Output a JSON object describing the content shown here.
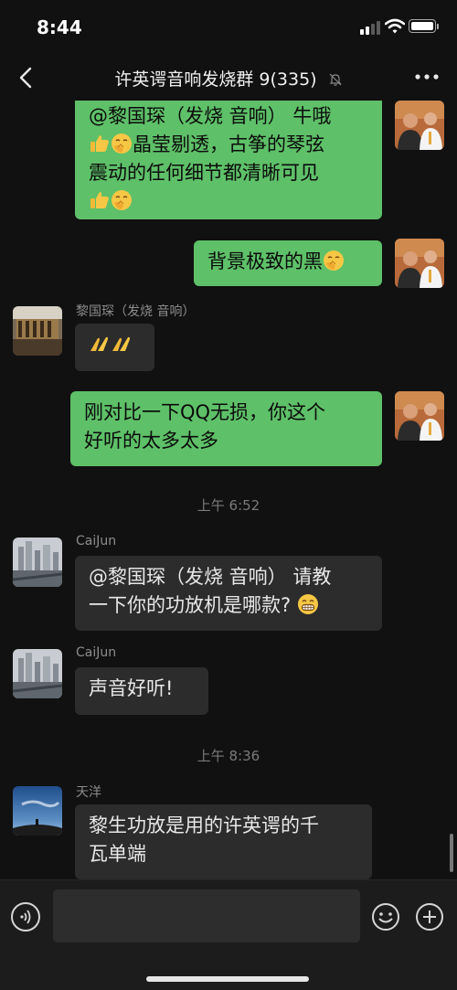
{
  "status": {
    "time": "8:44"
  },
  "header": {
    "title": "许英谔音响发烧群 9(335)"
  },
  "messages": {
    "m1": {
      "line1": "@黎国琛（发烧 音响） 牛哦",
      "line2_text": "晶莹剔透，古筝的琴弦",
      "line3": "震动的任何细节都清晰可见"
    },
    "m2": {
      "text": "背景极致的黑"
    },
    "m3": {
      "sender": "黎国琛（发烧 音响）"
    },
    "m4": {
      "line1": "刚对比一下QQ无损，你这个",
      "line2": "好听的太多太多"
    },
    "time1": "上午 6:52",
    "m5": {
      "sender": "CaiJun",
      "line1": "@黎国琛（发烧 音响） 请教",
      "line2": "一下你的功放机是哪款?"
    },
    "m6": {
      "sender": "CaiJun",
      "text": "声音好听!"
    },
    "time2": "上午 8:36",
    "m7": {
      "sender": "天洋",
      "line1": "黎生功放是用的许英谔的千",
      "line2": "瓦单端"
    }
  },
  "colors": {
    "my_bubble": "#5ec068",
    "other_bubble": "#2c2c2c",
    "background": "#111111"
  },
  "icons": [
    "back-icon",
    "mute-bell-icon",
    "more-icon",
    "voice-icon",
    "emoji-icon",
    "plus-icon",
    "thumbs-up-emoji",
    "shush-emoji",
    "clap-emoji",
    "grin-emoji"
  ]
}
